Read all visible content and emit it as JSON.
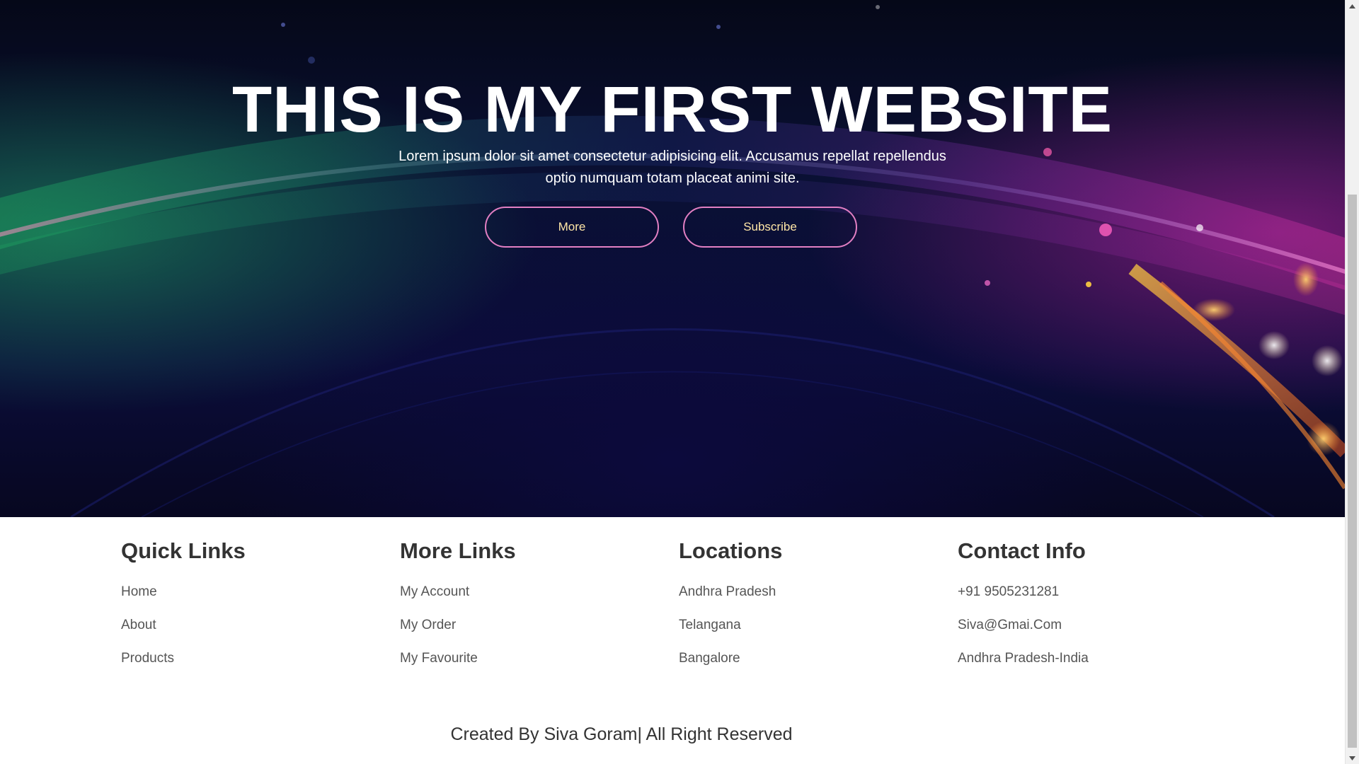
{
  "hero": {
    "title": "THIS IS MY FIRST WEBSITE",
    "text": "Lorem ipsum dolor sit amet consectetur adipisicing elit. Accusamus repellat repellendus optio numquam totam placeat animi site.",
    "buttons": {
      "more_label": "More",
      "subscribe_label": "Subscribe"
    }
  },
  "footer": {
    "columns": [
      {
        "heading": "Quick Links",
        "items": [
          "Home",
          "About",
          "Products"
        ]
      },
      {
        "heading": "More Links",
        "items": [
          "My Account",
          "My Order",
          "My Favourite"
        ]
      },
      {
        "heading": "Locations",
        "items": [
          "Andhra Pradesh",
          "Telangana",
          "Bangalore"
        ]
      },
      {
        "heading": "Contact Info",
        "items": [
          "+91 9505231281",
          "Siva@Gmai.Com",
          "Andhra Pradesh-India"
        ]
      }
    ],
    "credit": "Created By Siva Goram| All Right Reserved"
  },
  "colors": {
    "button_border": "#e27fc3",
    "button_text": "#ffe6a6",
    "heading": "#333333",
    "link": "#555555"
  }
}
